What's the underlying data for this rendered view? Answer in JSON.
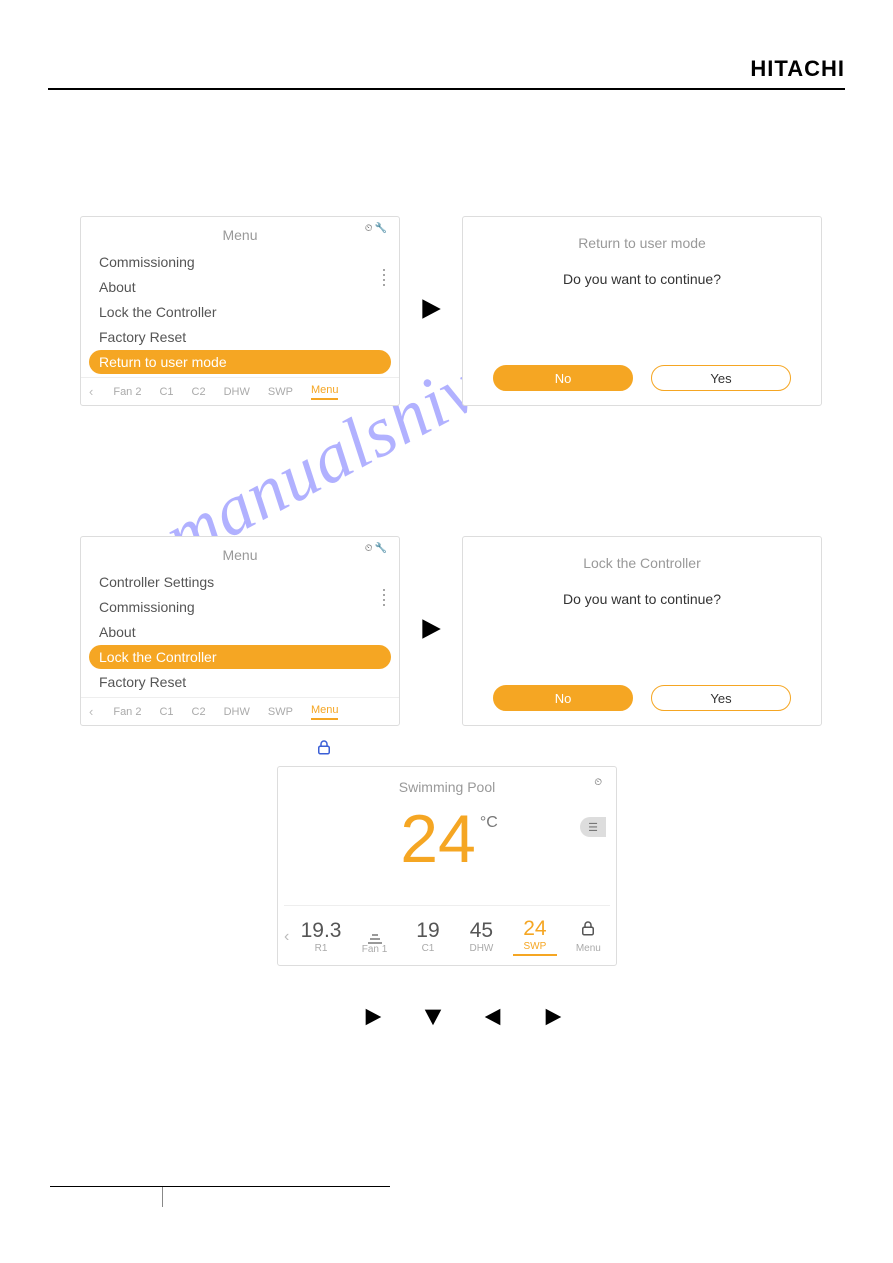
{
  "brand": "HITACHI",
  "watermark": "manualshive.com",
  "screen1": {
    "title": "Menu",
    "items": [
      "Commissioning",
      "About",
      "Lock the Controller",
      "Factory Reset",
      "Return to user mode"
    ],
    "selected": "Return to user mode",
    "tabs": [
      "Fan 2",
      "C1",
      "C2",
      "DHW",
      "SWP",
      "Menu"
    ],
    "active_tab": "Menu"
  },
  "confirm1": {
    "title": "Return to user mode",
    "message": "Do you want to continue?",
    "no": "No",
    "yes": "Yes"
  },
  "screen2": {
    "title": "Menu",
    "items": [
      "Controller Settings",
      "Commissioning",
      "About",
      "Lock the Controller",
      "Factory Reset"
    ],
    "selected": "Lock the Controller",
    "tabs": [
      "Fan 2",
      "C1",
      "C2",
      "DHW",
      "SWP",
      "Menu"
    ],
    "active_tab": "Menu"
  },
  "confirm2": {
    "title": "Lock the Controller",
    "message": "Do you want to continue?",
    "no": "No",
    "yes": "Yes"
  },
  "home": {
    "title": "Swimming Pool",
    "big_value": "24",
    "unit": "°C",
    "tabs": [
      {
        "val": "19.3",
        "lbl": "R1"
      },
      {
        "val": "fan-icon",
        "lbl": "Fan 1"
      },
      {
        "val": "19",
        "lbl": "C1"
      },
      {
        "val": "45",
        "lbl": "DHW"
      },
      {
        "val": "24",
        "lbl": "SWP"
      },
      {
        "val": "lock-icon",
        "lbl": "Menu"
      }
    ],
    "active_tab": "SWP"
  }
}
